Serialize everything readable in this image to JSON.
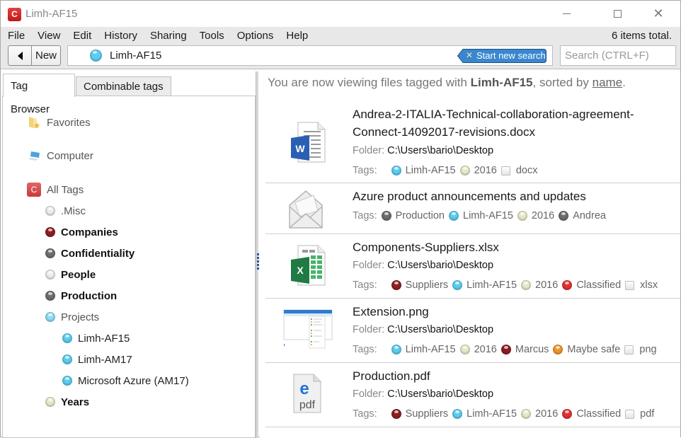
{
  "window": {
    "title": "Limh-AF15",
    "logo_letter": "C"
  },
  "menu": [
    "File",
    "View",
    "Edit",
    "History",
    "Sharing",
    "Tools",
    "Options",
    "Help"
  ],
  "status": {
    "items_total": "6 items total."
  },
  "toolbar": {
    "new_label": "New",
    "breadcrumb_tag": "Limh-AF15",
    "start_new_search": "Start new search",
    "search_placeholder": "Search (CTRL+F)",
    "search_value": ""
  },
  "colors": {
    "accent": "#3a87d0",
    "tag_cyan": "#5ccdf0",
    "tag_dark_red": "#8e1f22",
    "tag_gray": "#6f6f6f",
    "tag_light": "#ececec",
    "tag_year": "#e8e8c8",
    "tag_red": "#e23232",
    "tag_orange": "#f0962a"
  },
  "left_panel": {
    "tabs": [
      "Tag Browser",
      "Combinable tags"
    ],
    "roots": [
      {
        "label": "Favorites",
        "icon": "favorites-folder-icon"
      },
      {
        "label": "Computer",
        "icon": "computer-icon"
      },
      {
        "label": "All Tags",
        "icon": "all-tags-icon"
      }
    ],
    "tags": [
      {
        "label": ".Misc",
        "color": "light",
        "bold": false,
        "level": 1
      },
      {
        "label": "Companies",
        "color": "dark_red",
        "bold": true,
        "level": 1
      },
      {
        "label": "Confidentiality",
        "color": "gray",
        "bold": true,
        "level": 1
      },
      {
        "label": "People",
        "color": "light",
        "bold": true,
        "level": 1
      },
      {
        "label": "Production",
        "color": "gray",
        "bold": true,
        "level": 1
      },
      {
        "label": "Projects",
        "color": "cyan",
        "bold": false,
        "level": 1
      },
      {
        "label": "Limh-AF15",
        "color": "cyan",
        "bold": false,
        "level": 2
      },
      {
        "label": "Limh-AM17",
        "color": "cyan",
        "bold": false,
        "level": 2
      },
      {
        "label": "Microsoft Azure (AM17)",
        "color": "cyan",
        "bold": false,
        "level": 2
      },
      {
        "label": "Years",
        "color": "year",
        "bold": true,
        "level": 1
      }
    ]
  },
  "right_panel": {
    "viewing_prefix": "You are now viewing files tagged with ",
    "viewing_tag": "Limh-AF15",
    "viewing_mid": ", sorted by ",
    "viewing_sort": "name",
    "viewing_suffix": ".",
    "folder_label": "Folder:",
    "tags_label": "Tags:",
    "files": [
      {
        "name_line1": "Andrea-2-ITALIA-Technical-collaboration-agreement-",
        "name_line2": "Connect-14092017-revisions.docx",
        "icon": "word-document-icon",
        "folder": "C:\\Users\\bario\\Desktop",
        "tags": [
          {
            "label": "Limh-AF15",
            "color": "cyan"
          },
          {
            "label": "2016",
            "color": "year"
          },
          {
            "label": "docx",
            "color": "square"
          }
        ]
      },
      {
        "name_line1": "Azure product announcements and updates",
        "name_line2": "",
        "icon": "email-icon",
        "folder": "",
        "tags": [
          {
            "label": "Production",
            "color": "gray"
          },
          {
            "label": "Limh-AF15",
            "color": "cyan"
          },
          {
            "label": "2016",
            "color": "year"
          },
          {
            "label": "Andrea",
            "color": "gray"
          }
        ]
      },
      {
        "name_line1": "Components-Suppliers.xlsx",
        "name_line2": "",
        "icon": "excel-spreadsheet-icon",
        "folder": "C:\\Users\\bario\\Desktop",
        "tags": [
          {
            "label": "Suppliers",
            "color": "dark_red"
          },
          {
            "label": "Limh-AF15",
            "color": "cyan"
          },
          {
            "label": "2016",
            "color": "year"
          },
          {
            "label": "Classified",
            "color": "red"
          },
          {
            "label": "xlsx",
            "color": "square"
          }
        ]
      },
      {
        "name_line1": "Extension.png",
        "name_line2": "",
        "icon": "image-thumbnail-icon",
        "folder": "C:\\Users\\bario\\Desktop",
        "tags": [
          {
            "label": "Limh-AF15",
            "color": "cyan"
          },
          {
            "label": "2016",
            "color": "year"
          },
          {
            "label": "Marcus",
            "color": "dark_red"
          },
          {
            "label": "Maybe safe",
            "color": "orange"
          },
          {
            "label": "png",
            "color": "square"
          }
        ]
      },
      {
        "name_line1": "Production.pdf",
        "name_line2": "",
        "icon": "pdf-document-icon",
        "folder": "C:\\Users\\bario\\Desktop",
        "tags": [
          {
            "label": "Suppliers",
            "color": "dark_red"
          },
          {
            "label": "Limh-AF15",
            "color": "cyan"
          },
          {
            "label": "2016",
            "color": "year"
          },
          {
            "label": "Classified",
            "color": "red"
          },
          {
            "label": "pdf",
            "color": "square"
          }
        ]
      }
    ]
  }
}
